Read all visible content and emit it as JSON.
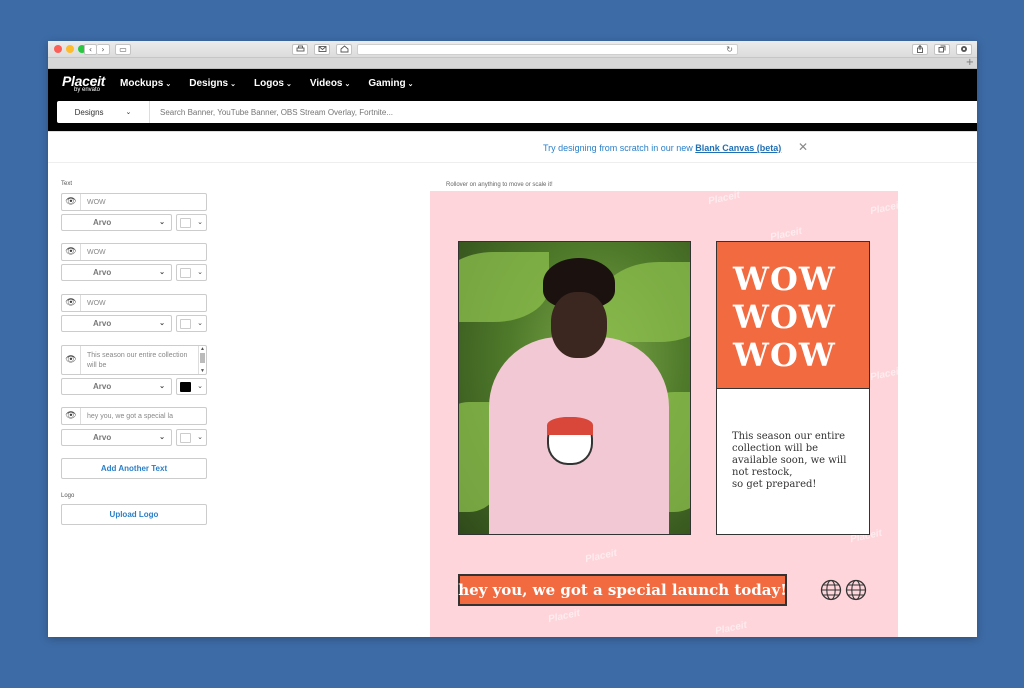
{
  "browser": {
    "nav_back": "‹",
    "nav_forward": "›",
    "sidebar_toggle": "▭",
    "reload": "↻",
    "new_tab": "+"
  },
  "site": {
    "logo": "Placeit",
    "logo_sub": "by envato",
    "nav": [
      {
        "label": "Mockups"
      },
      {
        "label": "Designs"
      },
      {
        "label": "Logos"
      },
      {
        "label": "Videos"
      },
      {
        "label": "Gaming"
      }
    ],
    "search": {
      "category": "Designs",
      "placeholder": "Search Banner, YouTube Banner, OBS Stream Overlay, Fortnite..."
    }
  },
  "banner": {
    "text": "Try designing from scratch in our new",
    "link": "Blank Canvas (beta)",
    "close": "✕"
  },
  "editor": {
    "section_text": "Text",
    "section_logo": "Logo",
    "fields": [
      {
        "value": "WOW",
        "font": "Arvo",
        "color": "#ffffff"
      },
      {
        "value": "WOW",
        "font": "Arvo",
        "color": "#ffffff"
      },
      {
        "value": "WOW",
        "font": "Arvo",
        "color": "#ffffff"
      },
      {
        "value": "This season our entire collection will be",
        "font": "Arvo",
        "color": "#000000"
      },
      {
        "value": "hey you, we got a special la",
        "font": "Arvo",
        "color": "#ffffff"
      }
    ],
    "add_text_button": "Add Another Text",
    "upload_logo_button": "Upload Logo"
  },
  "canvas": {
    "hint": "Rollover on anything to move or scale it!",
    "watermark": "Placeit",
    "headline_lines": [
      "WOW",
      "WOW",
      "WOW"
    ],
    "body": "This season our entire\ncollection will be\navailable soon, we will\nnot restock,\nso get prepared!",
    "launch": "hey you, we got a special launch today!",
    "accent_color": "#f26a40",
    "background_color": "#fdd5db"
  }
}
